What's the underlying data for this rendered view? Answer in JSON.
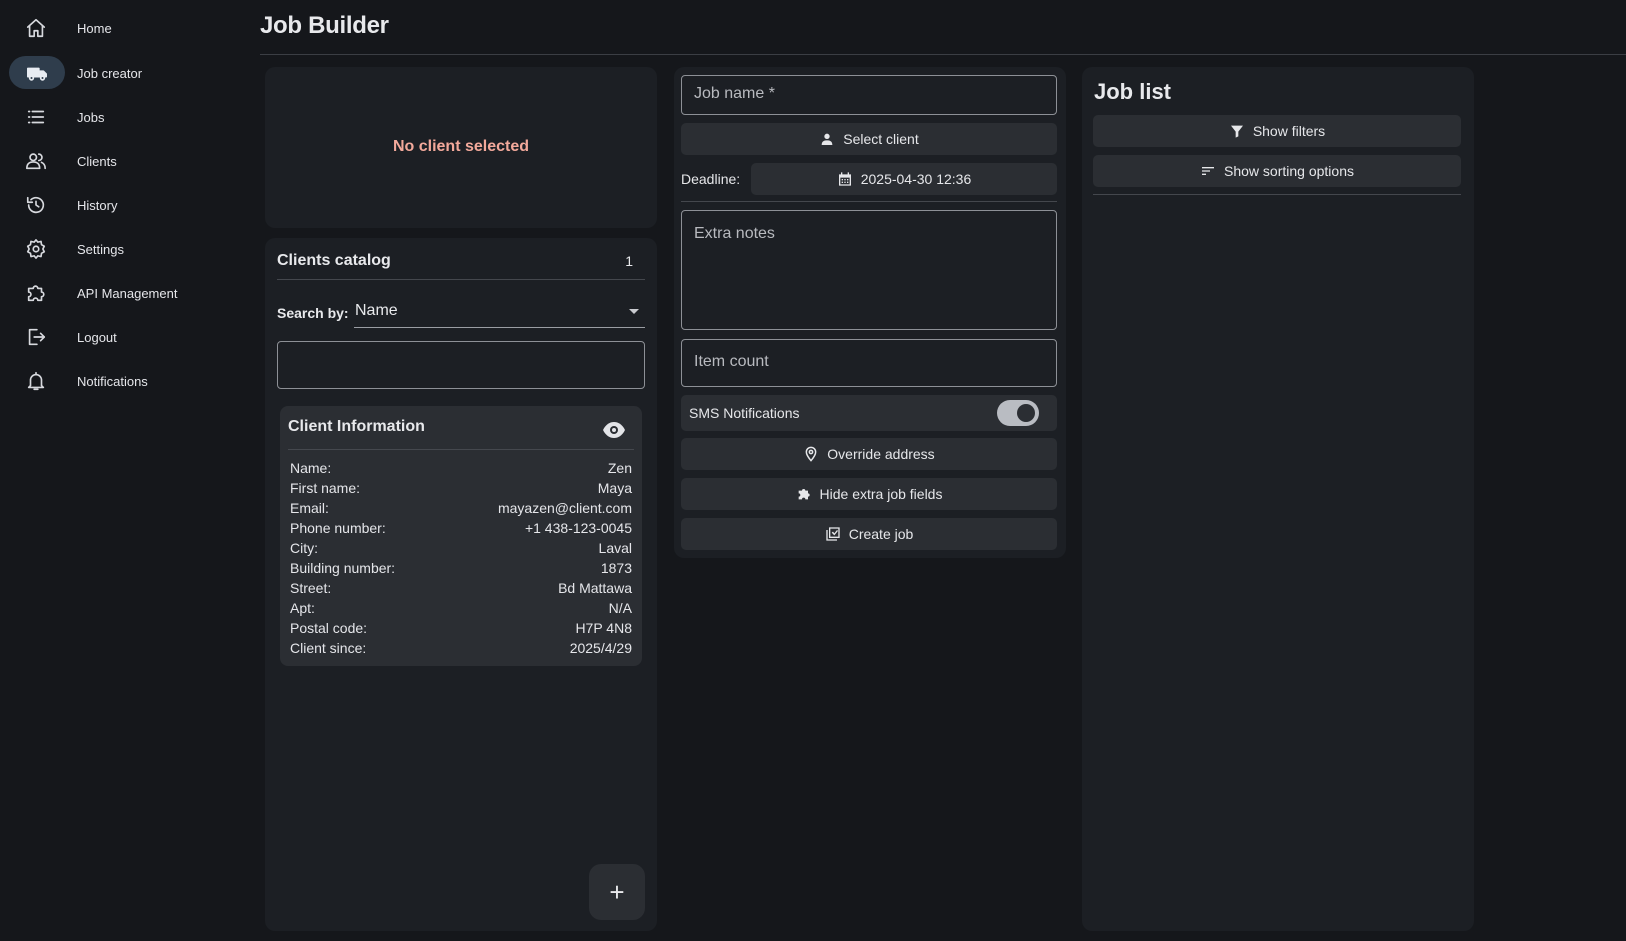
{
  "sidebar": {
    "items": [
      {
        "label": "Home",
        "icon": "home-icon"
      },
      {
        "label": "Job creator",
        "icon": "moving-truck-icon"
      },
      {
        "label": "Jobs",
        "icon": "list-icon"
      },
      {
        "label": "Clients",
        "icon": "people-icon"
      },
      {
        "label": "History",
        "icon": "history-icon"
      },
      {
        "label": "Settings",
        "icon": "gear-icon"
      },
      {
        "label": "API Management",
        "icon": "puzzle-icon"
      },
      {
        "label": "Logout",
        "icon": "logout-icon"
      },
      {
        "label": "Notifications",
        "icon": "bell-icon"
      }
    ]
  },
  "header": {
    "title": "Job Builder"
  },
  "selected_client": {
    "text": "No client selected"
  },
  "catalog": {
    "title": "Clients catalog",
    "count": "1",
    "search_by_label": "Search by:",
    "search_by_value": "Name",
    "search_value": "",
    "add_button": "+"
  },
  "client_info": {
    "title": "Client Information",
    "rows": [
      {
        "k": "Name:",
        "v": "Zen"
      },
      {
        "k": "First name:",
        "v": "Maya"
      },
      {
        "k": "Email:",
        "v": "mayazen@client.com"
      },
      {
        "k": "Phone number:",
        "v": "+1 438-123-0045"
      },
      {
        "k": "City:",
        "v": "Laval"
      },
      {
        "k": "Building number:",
        "v": "1873"
      },
      {
        "k": "Street:",
        "v": "Bd Mattawa"
      },
      {
        "k": "Apt:",
        "v": "N/A"
      },
      {
        "k": "Postal code:",
        "v": "H7P 4N8"
      },
      {
        "k": "Client since:",
        "v": "2025/4/29"
      }
    ]
  },
  "job_form": {
    "job_name_label": "Job name *",
    "select_client": "Select client",
    "deadline_label": "Deadline:",
    "deadline_value": "2025-04-30 12:36",
    "extra_notes_label": "Extra notes",
    "item_count_label": "Item count",
    "sms_label": "SMS Notifications",
    "sms_enabled": true,
    "override_address": "Override address",
    "hide_extra_fields": "Hide extra job fields",
    "create_job": "Create job"
  },
  "job_list": {
    "title": "Job list",
    "show_filters": "Show filters",
    "show_sorting": "Show sorting options"
  },
  "colors": {
    "background": "#15171b",
    "panel": "#1c1f24",
    "button": "#2b2e33",
    "warning_text": "#f3a99b",
    "active_nav": "#2f3d4c"
  }
}
